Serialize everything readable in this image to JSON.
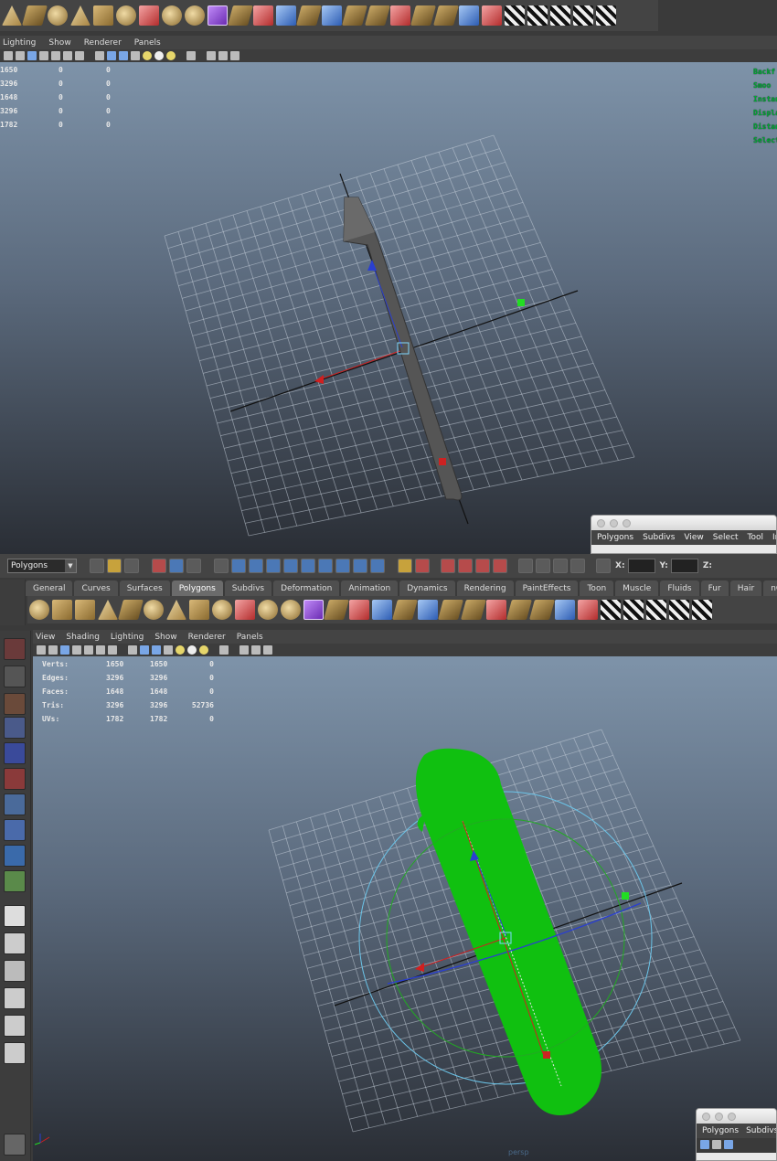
{
  "top_panel": {
    "menu": [
      "Lighting",
      "Show",
      "Renderer",
      "Panels"
    ],
    "hud_left": [
      [
        "1650",
        "0",
        "0"
      ],
      [
        "3296",
        "0",
        "0"
      ],
      [
        "1648",
        "0",
        "0"
      ],
      [
        "3296",
        "0",
        "0"
      ],
      [
        "1782",
        "0",
        "0"
      ]
    ],
    "hud_right": [
      "Backf",
      "Smoo",
      "Instan",
      "Displa",
      "Distan",
      "Select"
    ]
  },
  "small_window_1": {
    "menu": [
      "Polygons",
      "Subdivs",
      "View",
      "Select",
      "Tool",
      "In"
    ]
  },
  "main": {
    "mode_select": "Polygons",
    "coord_x_label": "X:",
    "coord_y_label": "Y:",
    "coord_z_label": "Z:",
    "shelf_tabs": [
      "General",
      "Curves",
      "Surfaces",
      "Polygons",
      "Subdivs",
      "Deformation",
      "Animation",
      "Dynamics",
      "Rendering",
      "PaintEffects",
      "Toon",
      "Muscle",
      "Fluids",
      "Fur",
      "Hair",
      "nCloth"
    ],
    "active_tab": "Polygons",
    "panel_menu": [
      "View",
      "Shading",
      "Lighting",
      "Show",
      "Renderer",
      "Panels"
    ],
    "hud": [
      {
        "label": "Verts:",
        "a": "1650",
        "b": "1650",
        "c": "0"
      },
      {
        "label": "Edges:",
        "a": "3296",
        "b": "3296",
        "c": "0"
      },
      {
        "label": "Faces:",
        "a": "1648",
        "b": "1648",
        "c": "0"
      },
      {
        "label": "Tris:",
        "a": "3296",
        "b": "3296",
        "c": "52736"
      },
      {
        "label": "UVs:",
        "a": "1782",
        "b": "1782",
        "c": "0"
      }
    ],
    "camera_label": "persp"
  },
  "small_window_2": {
    "menu": [
      "Polygons",
      "Subdivs"
    ]
  },
  "colors": {
    "viewport_top": "#7e93a9",
    "viewport_bottom": "#2a2e35",
    "hair_green": "#10c010",
    "axis_red": "#d11f1f",
    "axis_green": "#22dd22",
    "axis_blue": "#2a3fd0"
  }
}
